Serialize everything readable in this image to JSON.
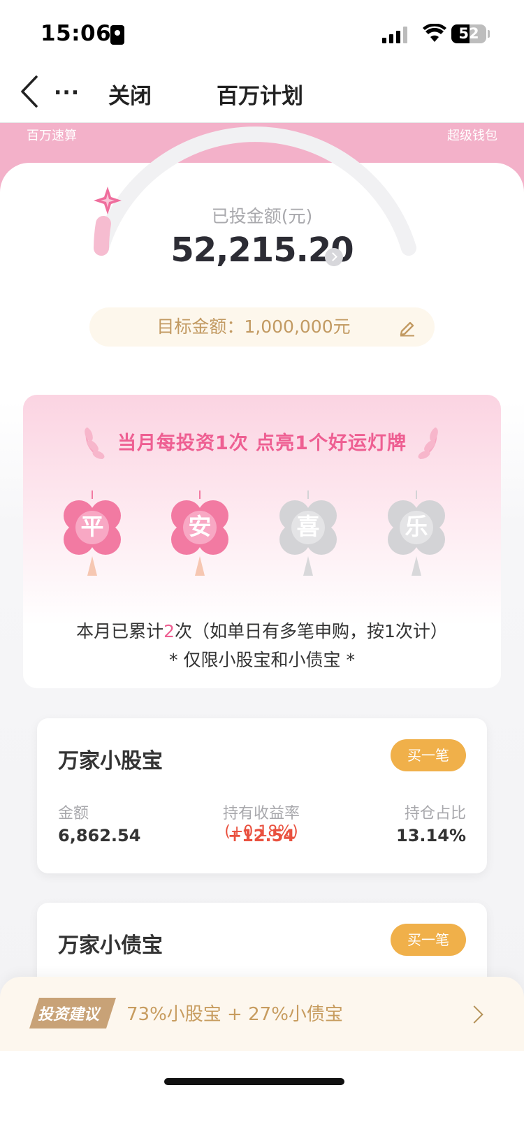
{
  "status_bar": {
    "time": "15:06",
    "battery": "52",
    "battery_level": 0.52
  },
  "nav": {
    "more": "...",
    "close": "关闭",
    "title": "百万计划"
  },
  "header": {
    "left_tag": "百万速算",
    "right_tag": "超级钱包"
  },
  "progress": {
    "invested_label": "已投金额(元)",
    "invested_amount": "52,215.20",
    "target_text": "目标金额：1,000,000元",
    "progress_fraction": 0.052
  },
  "campaign": {
    "title": "当月每投资1次 点亮1个好运灯牌",
    "lanterns": [
      {
        "char": "平",
        "lit": true
      },
      {
        "char": "安",
        "lit": true
      },
      {
        "char": "喜",
        "lit": false
      },
      {
        "char": "乐",
        "lit": false
      }
    ],
    "count_prefix": "本月已累计",
    "count": "2",
    "count_suffix": "次（如单日有多笔申购，按1次计）",
    "note": "* 仅限小股宝和小债宝 *"
  },
  "funds": [
    {
      "name": "万家小股宝",
      "buy_label": "买一笔",
      "amount_label": "金额",
      "amount": "6,862.54",
      "return_label": "持有收益率",
      "return_rate": "(+0.18%)",
      "return_value": "+12.54",
      "ratio_label": "持仓占比",
      "ratio": "13.14%"
    },
    {
      "name": "万家小债宝",
      "buy_label": "买一笔"
    }
  ],
  "advice": {
    "badge": "投资建议",
    "text": "73%小股宝 + 27%小债宝"
  },
  "colors": {
    "pink": "#f3b1c9",
    "accent_pink": "#ee5f92",
    "gold": "#f0b04a",
    "red": "#e9513f"
  }
}
